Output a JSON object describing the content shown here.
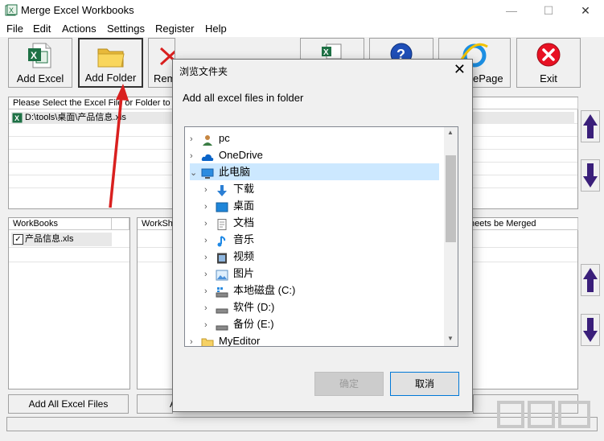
{
  "window": {
    "title": "Merge Excel Workbooks"
  },
  "menu": [
    "File",
    "Edit",
    "Actions",
    "Settings",
    "Register",
    "Help"
  ],
  "toolbar": {
    "add_excel": "Add Excel",
    "add_folder": "Add Folder",
    "remove": "Rem",
    "homepage": "ePage",
    "exit": "Exit"
  },
  "file_panel": {
    "header": "Please Select the Excel File or Folder to M",
    "rows": [
      "D:\\tools\\桌面\\产品信息.xls"
    ]
  },
  "workbooks_panel": {
    "header": "WorkBooks",
    "rows": [
      "产品信息.xls"
    ]
  },
  "worksheets_panel": {
    "header": "WorkSh",
    "merged_header": "heets be Merged"
  },
  "bottom": {
    "add_all": "Add All Excel Files",
    "second": "A"
  },
  "dialog": {
    "title": "浏览文件夹",
    "instruction": "Add all excel files in folder",
    "tree": [
      {
        "label": "pc",
        "icon": "user-icon",
        "level": 0,
        "expanded": false
      },
      {
        "label": "OneDrive",
        "icon": "cloud-icon",
        "level": 0,
        "expanded": false
      },
      {
        "label": "此电脑",
        "icon": "computer-icon",
        "level": 0,
        "expanded": true,
        "selected": true
      },
      {
        "label": "下载",
        "icon": "download-icon",
        "level": 1,
        "expanded": false
      },
      {
        "label": "桌面",
        "icon": "desktop-icon",
        "level": 1,
        "expanded": false
      },
      {
        "label": "文档",
        "icon": "document-icon",
        "level": 1,
        "expanded": false
      },
      {
        "label": "音乐",
        "icon": "music-icon",
        "level": 1,
        "expanded": false
      },
      {
        "label": "视频",
        "icon": "video-icon",
        "level": 1,
        "expanded": false
      },
      {
        "label": "图片",
        "icon": "picture-icon",
        "level": 1,
        "expanded": false
      },
      {
        "label": "本地磁盘 (C:)",
        "icon": "system-drive-icon",
        "level": 1,
        "expanded": false
      },
      {
        "label": "软件 (D:)",
        "icon": "drive-icon",
        "level": 1,
        "expanded": false
      },
      {
        "label": "备份 (E:)",
        "icon": "drive-icon",
        "level": 1,
        "expanded": false
      },
      {
        "label": "MyEditor",
        "icon": "folder-icon",
        "level": 0,
        "expanded": false
      }
    ],
    "ok": "确定",
    "cancel": "取消"
  },
  "colors": {
    "selection": "#cce8ff",
    "exit_red": "#e81123",
    "accent": "#0078d7",
    "arrow_red": "#d9201f",
    "nav_arrow": "#3a1f7a"
  }
}
